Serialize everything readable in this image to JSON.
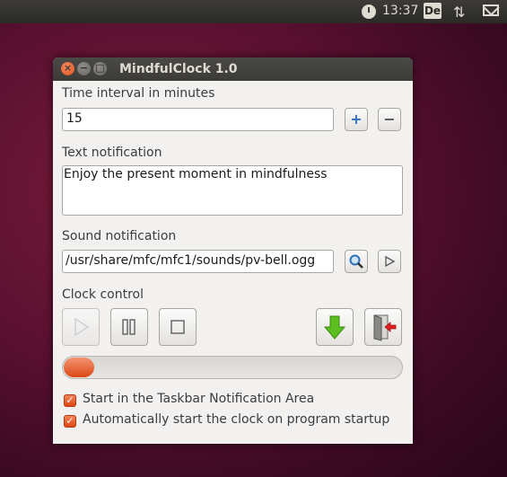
{
  "panel": {
    "time": "13:37",
    "keyboard_layout": "De",
    "icons": [
      "clock-icon",
      "network-icon",
      "mail-icon"
    ]
  },
  "window": {
    "title": "MindfulClock 1.0",
    "close": "×",
    "minimize": "−",
    "maximize": "□"
  },
  "interval": {
    "label": "Time interval in minutes",
    "value": "15",
    "plus": "+",
    "minus": "−"
  },
  "text_notification": {
    "label": "Text notification",
    "value": "Enjoy the present moment in mindfulness"
  },
  "sound_notification": {
    "label": "Sound notification",
    "value": "/usr/share/mfc/mfc1/sounds/pv-bell.ogg"
  },
  "clock_control": {
    "label": "Clock control",
    "buttons": [
      "play-icon",
      "pause-icon",
      "stop-icon",
      "minimize-to-tray-icon",
      "quit-icon"
    ],
    "progress_fraction": 0.09
  },
  "options": {
    "taskbar": {
      "label": "Start in the Taskbar Notification Area",
      "checked": true
    },
    "autostart": {
      "label": "Automatically start the clock on program startup",
      "checked": true
    }
  },
  "colors": {
    "accent": "#dd4814",
    "green_arrow": "#4caf1a",
    "red_arrow": "#d41a1a",
    "icon_blue": "#2f6fb6"
  }
}
